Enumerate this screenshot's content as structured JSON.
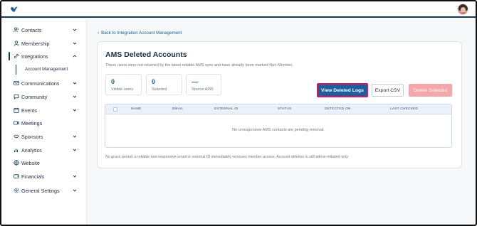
{
  "app": {
    "logo_icon": "bird-logo-icon",
    "avatar_icon": "user-avatar"
  },
  "sidebar": {
    "items": [
      {
        "label": "Contacts",
        "icon": "people-icon",
        "expandable": true
      },
      {
        "label": "Membership",
        "icon": "user-icon",
        "expandable": true
      },
      {
        "label": "Integrations",
        "icon": "link-icon",
        "expandable": true,
        "expanded": true
      },
      {
        "label": "Communications",
        "icon": "mail-icon",
        "expandable": true
      },
      {
        "label": "Community",
        "icon": "chat-icon",
        "expandable": true
      },
      {
        "label": "Events",
        "icon": "calendar-icon",
        "expandable": true
      },
      {
        "label": "Meetings",
        "icon": "video-icon",
        "expandable": false
      },
      {
        "label": "Sponsors",
        "icon": "handshake-icon",
        "expandable": true
      },
      {
        "label": "Analytics",
        "icon": "bar-chart-icon",
        "expandable": true
      },
      {
        "label": "Website",
        "icon": "globe-icon",
        "expandable": false
      },
      {
        "label": "Financials",
        "icon": "wallet-icon",
        "expandable": true
      },
      {
        "label": "General Settings",
        "icon": "gear-icon",
        "expandable": true
      }
    ],
    "subitem": "Account Management"
  },
  "breadcrumb": {
    "back_label": "Back to Integration Account Management"
  },
  "page": {
    "title": "AMS Deleted Accounts",
    "subtitle": "These users were not returned by the latest reliable AMS sync and have already been marked Non-Member."
  },
  "stats": [
    {
      "value": "0",
      "label": "Visible users"
    },
    {
      "value": "0",
      "label": "Selected"
    },
    {
      "value": "—",
      "label": "Source AMS"
    }
  ],
  "actions": {
    "view_logs": "View Deleted Logs",
    "export": "Export CSV",
    "delete": "Delete Selected"
  },
  "table": {
    "columns": [
      "NAME",
      "EMAIL",
      "EXTERNAL ID",
      "STATUS",
      "DETECTED ON",
      "LAST CHECKED"
    ],
    "empty_message": "No unresponsive AMS contacts are pending removal."
  },
  "footnote": "No grace period: a reliable non-responsive email or external ID immediately removes member access. Account deletion is still admin-initiated only.",
  "colors": {
    "primary": "#1b5e9e",
    "highlight_border": "#d6175f",
    "delete_disabled": "#f4a7ab",
    "nav_dark": "#0f3b54"
  }
}
